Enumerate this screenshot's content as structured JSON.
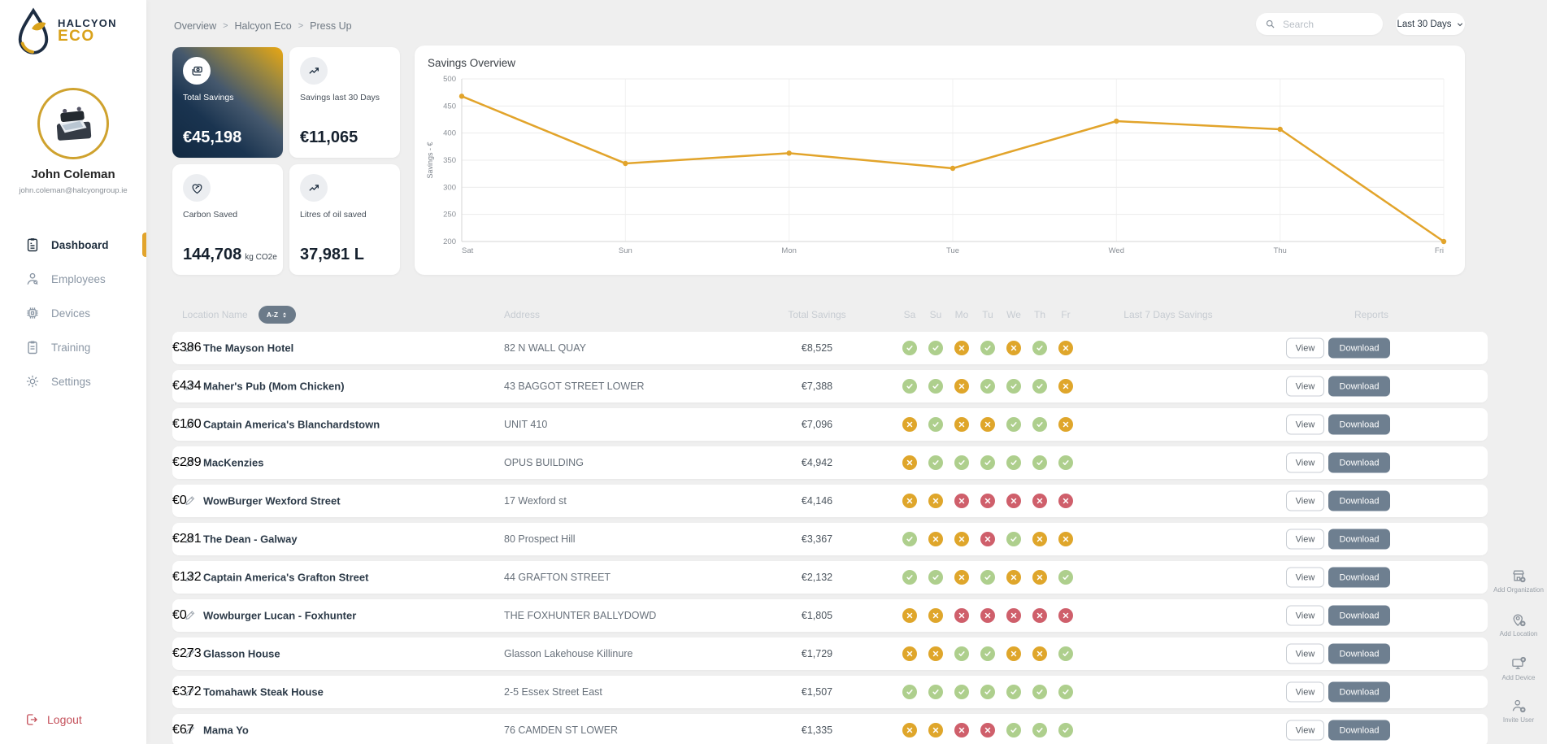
{
  "sidebar": {
    "logo": {
      "line1": "HALCYON",
      "line2": "ECO"
    },
    "user": {
      "name": "John Coleman",
      "email": "john.coleman@halcyongroup.ie"
    },
    "nav": [
      {
        "label": "Dashboard",
        "active": true
      },
      {
        "label": "Employees",
        "active": false
      },
      {
        "label": "Devices",
        "active": false
      },
      {
        "label": "Training",
        "active": false
      },
      {
        "label": "Settings",
        "active": false
      }
    ],
    "logout_label": "Logout"
  },
  "header": {
    "breadcrumb": [
      "Overview",
      "Halcyon Eco",
      "Press Up"
    ],
    "search_placeholder": "Search",
    "range_selector": "Last 30 Days"
  },
  "stats": [
    {
      "label": "Total Savings",
      "value": "€45,198",
      "suffix": "",
      "style": "dark"
    },
    {
      "label": "Savings last 30 Days",
      "value": "€11,065",
      "suffix": "",
      "style": "light"
    },
    {
      "label": "Carbon Saved",
      "value": "144,708",
      "suffix": "kg CO2e",
      "style": "light"
    },
    {
      "label": "Litres of oil saved",
      "value": "37,981 L",
      "suffix": "",
      "style": "light"
    }
  ],
  "chart_data": {
    "type": "line",
    "title": "Savings Overview",
    "ylabel": "Savings - €",
    "x": [
      "Sat",
      "Sun",
      "Mon",
      "Tue",
      "Wed",
      "Thu",
      "Fri"
    ],
    "values": [
      468,
      344,
      363,
      335,
      422,
      407,
      200
    ],
    "ylim": [
      200,
      500
    ],
    "yticks": [
      200,
      250,
      300,
      350,
      400,
      450,
      500
    ],
    "line_color": "#E2A42B",
    "grid": true,
    "legend": "none"
  },
  "table": {
    "headers": {
      "location": "Location Name",
      "sort_badge": "A-Z",
      "address": "Address",
      "total_savings": "Total Savings",
      "days": [
        "Sa",
        "Su",
        "Mo",
        "Tu",
        "We",
        "Th",
        "Fr"
      ],
      "last7": "Last 7 Days Savings",
      "reports": "Reports"
    },
    "view_label": "View",
    "download_label": "Download",
    "status_colors": {
      "ok": "#aecf8d",
      "warn": "#dfa62b",
      "bad": "#cf5f6b"
    },
    "rows": [
      {
        "name": "The Mayson Hotel",
        "address": "82 N WALL QUAY",
        "total": "€8,525",
        "days": [
          "ok",
          "ok",
          "warn",
          "ok",
          "warn",
          "ok",
          "warn"
        ],
        "last7": "€386"
      },
      {
        "name": "Maher's Pub (Mom Chicken)",
        "address": "43 BAGGOT STREET LOWER",
        "total": "€7,388",
        "days": [
          "ok",
          "ok",
          "warn",
          "ok",
          "ok",
          "ok",
          "warn"
        ],
        "last7": "€434"
      },
      {
        "name": "Captain America's Blanchardstown",
        "address": "UNIT 410",
        "total": "€7,096",
        "days": [
          "warn",
          "ok",
          "warn",
          "warn",
          "ok",
          "ok",
          "warn"
        ],
        "last7": "€160"
      },
      {
        "name": "MacKenzies",
        "address": "OPUS BUILDING",
        "total": "€4,942",
        "days": [
          "warn",
          "ok",
          "ok",
          "ok",
          "ok",
          "ok",
          "ok"
        ],
        "last7": "€289"
      },
      {
        "name": "WowBurger Wexford Street",
        "address": "17 Wexford st",
        "total": "€4,146",
        "days": [
          "warn",
          "warn",
          "bad",
          "bad",
          "bad",
          "bad",
          "bad"
        ],
        "last7": "€0"
      },
      {
        "name": "The Dean - Galway",
        "address": "80 Prospect Hill",
        "total": "€3,367",
        "days": [
          "ok",
          "warn",
          "warn",
          "bad",
          "ok",
          "warn",
          "warn"
        ],
        "last7": "€281"
      },
      {
        "name": "Captain America's Grafton Street",
        "address": "44 GRAFTON STREET",
        "total": "€2,132",
        "days": [
          "ok",
          "ok",
          "warn",
          "ok",
          "warn",
          "warn",
          "ok"
        ],
        "last7": "€132"
      },
      {
        "name": "Wowburger Lucan - Foxhunter",
        "address": "THE FOXHUNTER BALLYDOWD",
        "total": "€1,805",
        "days": [
          "warn",
          "warn",
          "bad",
          "bad",
          "bad",
          "bad",
          "bad"
        ],
        "last7": "€0"
      },
      {
        "name": "Glasson House",
        "address": "Glasson Lakehouse Killinure",
        "total": "€1,729",
        "days": [
          "warn",
          "warn",
          "ok",
          "ok",
          "warn",
          "warn",
          "ok"
        ],
        "last7": "€273"
      },
      {
        "name": "Tomahawk Steak House",
        "address": "2-5 Essex Street East",
        "total": "€1,507",
        "days": [
          "ok",
          "ok",
          "ok",
          "ok",
          "ok",
          "ok",
          "ok"
        ],
        "last7": "€372"
      },
      {
        "name": "Mama Yo",
        "address": "76 CAMDEN ST LOWER",
        "total": "€1,335",
        "days": [
          "warn",
          "warn",
          "bad",
          "bad",
          "ok",
          "ok",
          "ok"
        ],
        "last7": "€67"
      }
    ]
  },
  "right_rail": [
    {
      "label": "Add Organization"
    },
    {
      "label": "Add Location"
    },
    {
      "label": "Add Device"
    },
    {
      "label": "Invite User"
    }
  ],
  "colors": {
    "accent_gold": "#E2A42B",
    "navy": "#142B43",
    "logout_red": "#C4505A",
    "status_ok": "#AECF8D",
    "status_warn": "#DFA62B",
    "status_bad": "#CF5F6B"
  }
}
